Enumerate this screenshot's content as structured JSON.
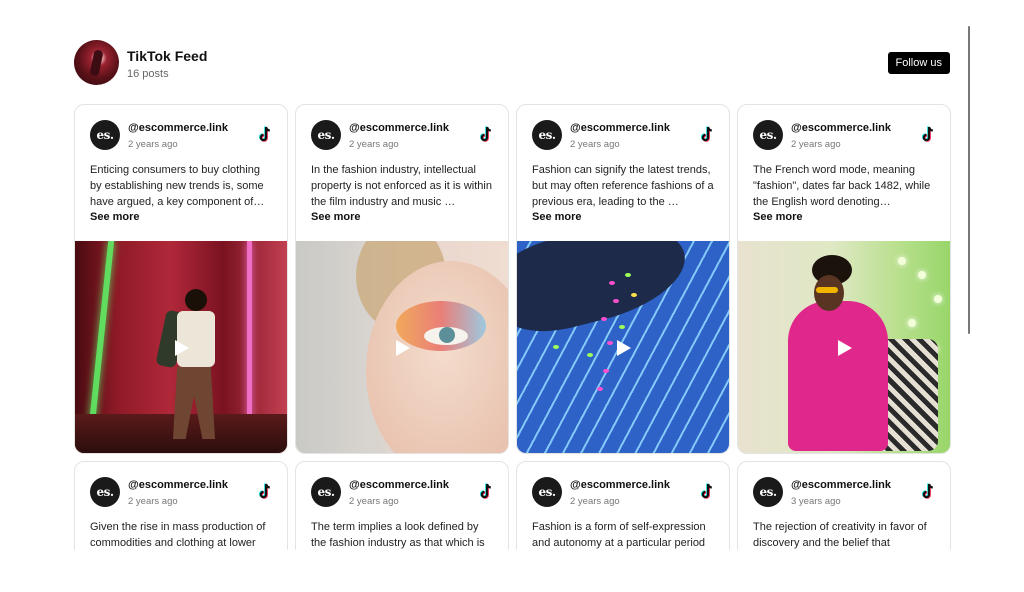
{
  "header": {
    "title": "TikTok Feed",
    "post_count": "16 posts",
    "follow_label": "Follow us"
  },
  "icons": {
    "avatar": "profile-avatar",
    "brand_logo": "es-logo",
    "platform": "tiktok-icon",
    "play": "play-icon"
  },
  "logo_text": "es.",
  "see_more_label": "See more",
  "posts": [
    {
      "username": "@escommerce.link",
      "time": "2 years ago",
      "text": "Enticing consumers to buy clothing by establishing new trends is, some have argued, a key component of the…"
    },
    {
      "username": "@escommerce.link",
      "time": "2 years ago",
      "text": "In the fashion industry, intellectual property is not enforced as it is within the film industry and music …"
    },
    {
      "username": "@escommerce.link",
      "time": "2 years ago",
      "text": "Fashion can signify the latest trends, but may often reference fashions of a previous era, leading to the …"
    },
    {
      "username": "@escommerce.link",
      "time": "2 years ago",
      "text": "The French word mode, meaning \"fashion\", dates far back 1482, while the English word denoting somethin…"
    },
    {
      "username": "@escommerce.link",
      "time": "2 years ago",
      "text": "Given the rise in mass production of commodities and clothing at lower"
    },
    {
      "username": "@escommerce.link",
      "time": "2 years ago",
      "text": "The term implies a look defined by the fashion industry as that which is"
    },
    {
      "username": "@escommerce.link",
      "time": "2 years ago",
      "text": "Fashion is a form of self-expression and autonomy at a particular period"
    },
    {
      "username": "@escommerce.link",
      "time": "3 years ago",
      "text": "The rejection of creativity in favor of discovery and the belief that"
    }
  ],
  "colors": {
    "follow_button_bg": "#000000",
    "card_border": "#e3e3e3",
    "neon_green": "#5dff6a",
    "neon_pink": "#ff7be0",
    "stripe_blue": "#2e62c6",
    "suit_pink": "#e0278b"
  }
}
